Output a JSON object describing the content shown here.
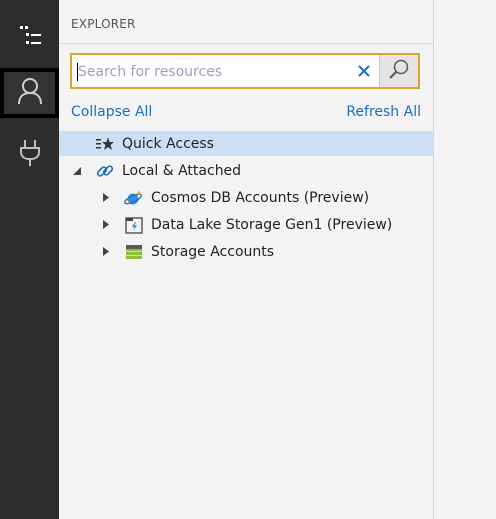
{
  "activity_bar": {
    "items": [
      {
        "name": "explorer",
        "icon": "explorer-list-icon"
      },
      {
        "name": "account",
        "icon": "person-icon",
        "active": true
      },
      {
        "name": "connect",
        "icon": "plug-icon"
      }
    ]
  },
  "explorer": {
    "title": "EXPLORER",
    "search": {
      "placeholder": "Search for resources",
      "value": ""
    },
    "collapse_all_label": "Collapse All",
    "refresh_all_label": "Refresh All",
    "tree": [
      {
        "label": "Quick Access",
        "icon": "quick-access-icon",
        "selected": true
      },
      {
        "label": "Local & Attached",
        "icon": "link-icon",
        "expanded": true
      },
      {
        "label": "Cosmos DB Accounts (Preview)",
        "icon": "cosmos-db-icon",
        "expanded": false
      },
      {
        "label": "Data Lake Storage Gen1 (Preview)",
        "icon": "data-lake-icon",
        "expanded": false
      },
      {
        "label": "Storage Accounts",
        "icon": "storage-accounts-icon",
        "expanded": false
      }
    ]
  },
  "colors": {
    "activity_bar": "#2d2d2d",
    "selection": "#cce0f5",
    "link": "#1c6ebd",
    "search_border": "#d8a630"
  }
}
